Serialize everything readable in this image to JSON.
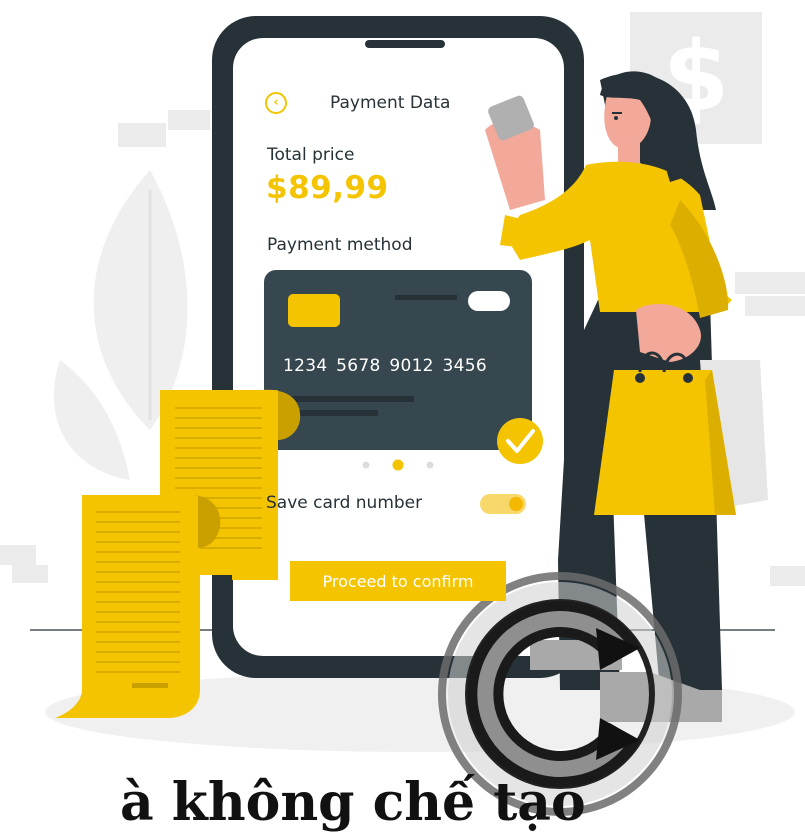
{
  "phone_screen": {
    "title": "Payment Data",
    "total_label": "Total price",
    "total_value": "$89,99",
    "method_label": "Payment method",
    "card_number": "1234  5678  9012  3456",
    "save_label": "Save card number",
    "save_toggle": "on",
    "card_page_indicator": {
      "current": 2,
      "total": 3
    },
    "proceed_label": "Proceed to confirm"
  },
  "background_sign": "$",
  "caption": "à không chế tạo",
  "colors": {
    "accent_yellow": "#f5c400",
    "dark": "#263238",
    "card": "#37474f",
    "light_gray": "#e8e8e8"
  },
  "icons": {
    "back": "back-circle-icon",
    "checkmark": "check-circle-icon",
    "watermark": "copyright-watermark-icon"
  }
}
